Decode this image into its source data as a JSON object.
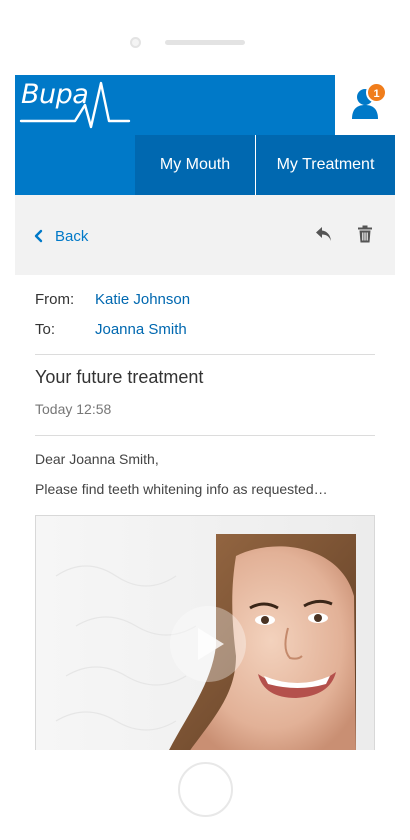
{
  "header": {
    "logo_text": "Bupa",
    "notification_count": "1",
    "tabs": [
      {
        "label": "My Mouth"
      },
      {
        "label": "My Treatment"
      }
    ]
  },
  "toolbar": {
    "back_label": "Back"
  },
  "message": {
    "from_label": "From:",
    "from_value": "Katie Johnson",
    "to_label": "To:",
    "to_value": "Joanna Smith",
    "subject": "Your future treatment",
    "time": "Today 12:58",
    "greeting": "Dear Joanna Smith,",
    "body": "Please find teeth whitening info as requested…"
  },
  "colors": {
    "brand_blue": "#0079c8",
    "nav_blue": "#0068b0",
    "badge_orange": "#f07d1b"
  }
}
